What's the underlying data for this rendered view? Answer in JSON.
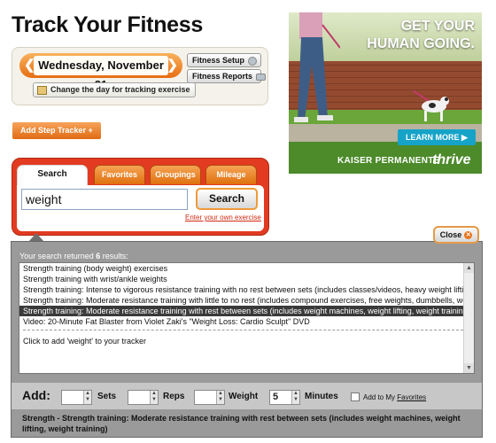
{
  "page": {
    "title": "Track Your Fitness"
  },
  "date_panel": {
    "date": "Wednesday, November 21",
    "fitness_setup": "Fitness Setup",
    "fitness_reports": "Fitness Reports",
    "change_day": "Change the day for tracking exercise",
    "prev_arrow": "❮",
    "next_arrow": "❯"
  },
  "step_tracker": {
    "label": "Add Step Tracker +"
  },
  "ad": {
    "headline_1": "GET YOUR",
    "headline_2": "HUMAN GOING.",
    "learn_more": "LEARN MORE ▶",
    "brand": "KAISER PERMANENTE",
    "brand_sub": "thrive"
  },
  "search": {
    "tabs": [
      "Search",
      "Favorites",
      "Groupings",
      "Mileage"
    ],
    "query": "weight",
    "button": "Search",
    "own_link": "Enter your own exercise"
  },
  "results": {
    "close": "Close",
    "summary_prefix": "Your search returned ",
    "count": "6",
    "summary_suffix": " results:",
    "items": [
      "Strength training (body weight) exercises",
      "Strength training with wrist/ankle weights",
      "Strength training: Intense to vigorous resistance training with no rest between sets (includes classes/videos, heavy weight lifting",
      "Strength training: Moderate resistance training with little to no rest (includes compound exercises, free weights, dumbbells, weight",
      "Strength training: Moderate resistance training with rest between sets (includes weight machines, weight lifting, weight training)",
      "Video: 20-Minute Fat Blaster from Violet Zaki's \"Weight Loss: Cardio Sculpt\" DVD"
    ],
    "selected_index": 4,
    "add_hint": "Click to add 'weight' to your tracker"
  },
  "add": {
    "label": "Add:",
    "sets_value": "",
    "sets_unit": "Sets",
    "reps_value": "",
    "reps_unit": "Reps",
    "weight_value": "",
    "weight_unit": "Weight",
    "minutes_value": "5",
    "minutes_unit": "Minutes",
    "favorites_prefix": "Add to My ",
    "favorites_link": "Favorites",
    "strength_text": "Strength - Strength training: Moderate resistance training with rest between sets (includes weight machines, weight lifting, weight training)"
  }
}
